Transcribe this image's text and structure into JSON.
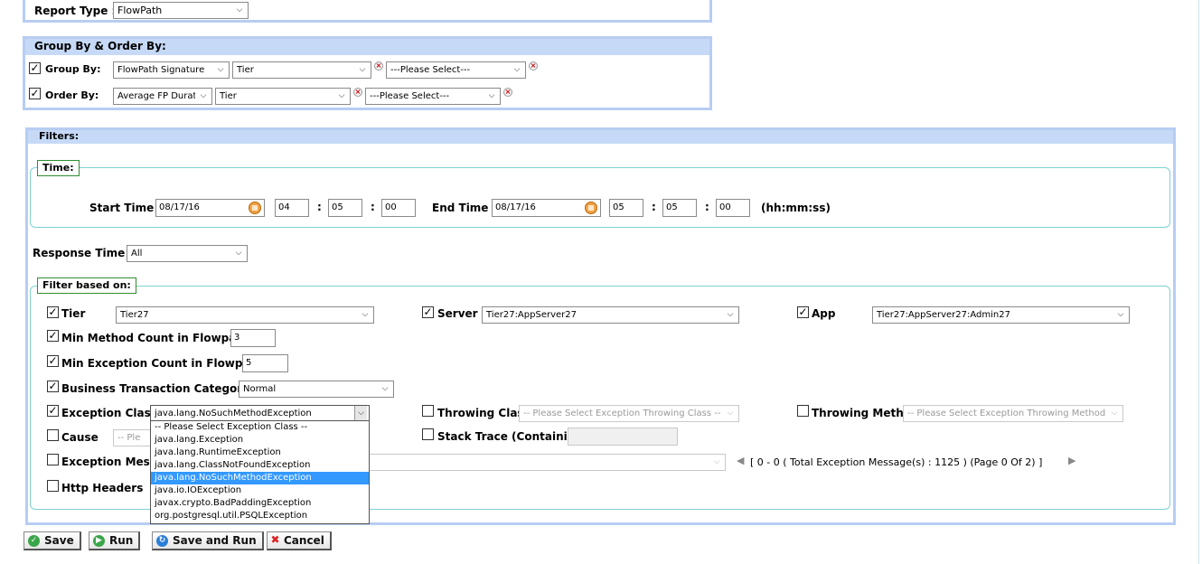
{
  "report_type": {
    "label": "Report Type :",
    "value": "FlowPath"
  },
  "group_order": {
    "title": "Group By & Order By:",
    "group_by": {
      "label": "Group By:",
      "sel1": "FlowPath Signature",
      "sel2": "Tier",
      "sel3": "---Please Select---"
    },
    "order_by": {
      "label": "Order By:",
      "sel1": "Average FP Duratic",
      "sel2": "Tier",
      "sel3": "---Please Select---"
    }
  },
  "filters": {
    "title": "Filters:",
    "time": {
      "legend": "Time:",
      "start_label": "Start Time",
      "start_date": "08/17/16",
      "start_hh": "04",
      "start_mm": "05",
      "start_ss": "00",
      "end_label": "End Time",
      "end_date": "08/17/16",
      "end_hh": "05",
      "end_mm": "05",
      "end_ss": "00",
      "sep": ":",
      "format": "(hh:mm:ss)"
    },
    "response_time": {
      "label": "Response Time",
      "value": "All"
    },
    "filter_based_on": {
      "legend": "Filter based on:",
      "tier": {
        "label": "Tier",
        "value": "Tier27"
      },
      "server": {
        "label": "Server",
        "value": "Tier27:AppServer27"
      },
      "app": {
        "label": "App",
        "value": "Tier27:AppServer27:Admin27"
      },
      "min_method": {
        "label": "Min Method Count in Flowpaths",
        "value": "3"
      },
      "min_exception": {
        "label": "Min Exception Count in Flowpaths",
        "value": "5"
      },
      "bt_category": {
        "label": "Business Transaction Category",
        "value": "Normal"
      },
      "exception_class": {
        "label": "Exception Class",
        "value": "java.lang.NoSuchMethodException"
      },
      "throwing_class": {
        "label": "Throwing Class",
        "placeholder": "-- Please Select Exception Throwing Class --"
      },
      "throwing_method": {
        "label": "Throwing Method",
        "placeholder": "-- Please Select Exception Throwing Method --"
      },
      "cause": {
        "label": "Cause",
        "placeholder": "-- Please"
      },
      "stack_trace": {
        "label": "Stack Trace (Containing)"
      },
      "exception_message": {
        "label": "Exception Messa",
        "pager": "[ 0 - 0 ( Total Exception Message(s) : 1125 ) (Page 0 Of 2) ]"
      },
      "http_headers": {
        "label": "Http Headers"
      }
    },
    "exception_options": [
      "-- Please Select Exception Class --",
      "java.lang.Exception",
      "java.lang.RuntimeException",
      "java.lang.ClassNotFoundException",
      "java.lang.NoSuchMethodException",
      "java.io.IOException",
      "javax.crypto.BadPaddingException",
      "org.postgresql.util.PSQLException"
    ]
  },
  "buttons": {
    "save": "Save",
    "run": "Run",
    "save_and_run": "Save and Run",
    "cancel": "Cancel"
  },
  "colors": {
    "header_bg": "#c6d9f7",
    "panel_border": "#b7cdf2",
    "teal_border": "#7fd2d2",
    "selected": "#3399ff"
  }
}
